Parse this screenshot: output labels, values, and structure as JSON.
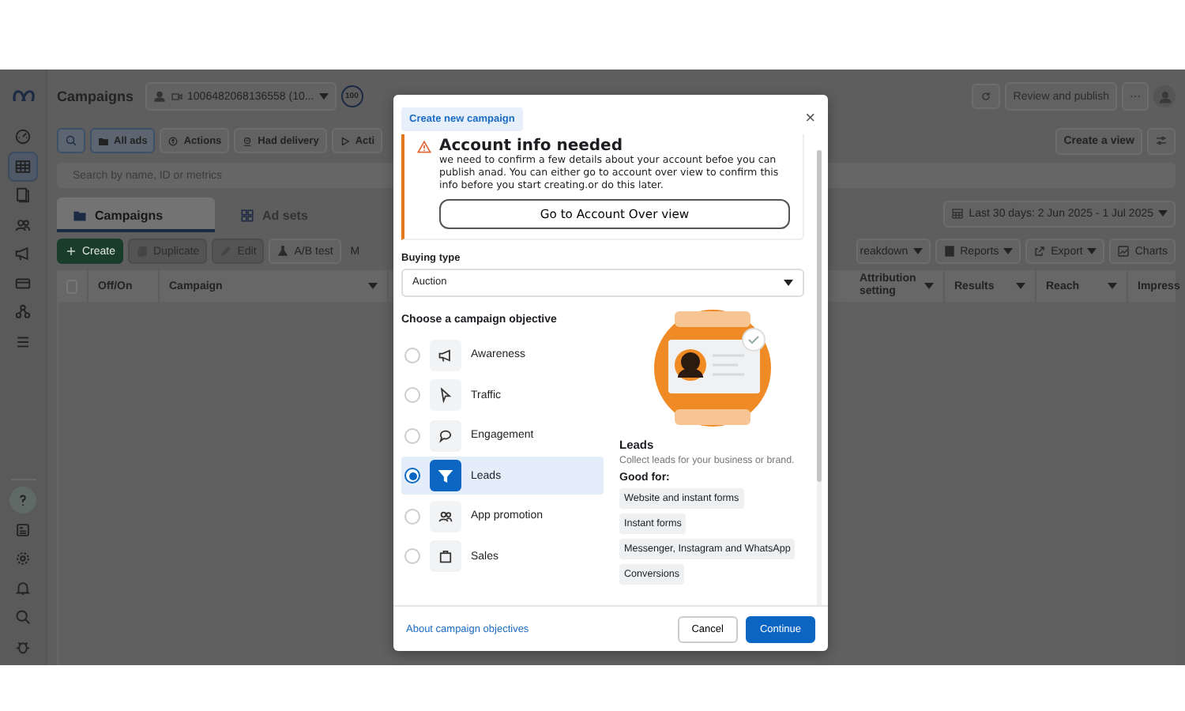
{
  "sidebar": {
    "top_items": [
      {
        "kind": "gauge",
        "selected": false
      },
      {
        "kind": "table",
        "selected": true
      },
      {
        "kind": "pages",
        "selected": false
      },
      {
        "kind": "people",
        "selected": false
      },
      {
        "kind": "megaphone",
        "selected": false
      },
      {
        "kind": "card",
        "selected": false
      },
      {
        "kind": "graph",
        "selected": false
      },
      {
        "kind": "menu",
        "selected": false
      }
    ],
    "bottom_items": [
      {
        "kind": "help",
        "selected": false
      },
      {
        "kind": "news",
        "selected": false
      },
      {
        "kind": "gear",
        "selected": false
      },
      {
        "kind": "bell",
        "selected": false
      },
      {
        "kind": "search",
        "selected": false
      },
      {
        "kind": "bug",
        "selected": false
      }
    ]
  },
  "top_bar": {
    "title": "Campaigns",
    "account": "1006482068136558 (10...",
    "score": "100",
    "publish_button": "Review and publish",
    "more_button": "···"
  },
  "filters": [
    {
      "label": "All ads",
      "kind": "folder",
      "selected": true
    },
    {
      "label": "Actions",
      "kind": "actions",
      "selected": false
    },
    {
      "label": "Had delivery",
      "kind": "delivery",
      "selected": false
    },
    {
      "label": "Acti",
      "kind": "play",
      "selected": false
    }
  ],
  "create_view_button": "Create a view",
  "search": {
    "placeholder": "Search by name, ID or metrics"
  },
  "tabs": [
    {
      "label": "Campaigns",
      "kind": "folder",
      "selected": true
    },
    {
      "label": "Ad sets",
      "kind": "grid",
      "selected": false
    }
  ],
  "date_range": "Last 30 days: 2 Jun 2025 - 1 Jul 2025",
  "toolbar_left": [
    {
      "label": "Create",
      "kind": "plus",
      "disabled": false,
      "primary": true
    },
    {
      "label": "Duplicate",
      "kind": "copy",
      "disabled": true,
      "primary": false
    },
    {
      "label": "Edit",
      "kind": "pencil",
      "disabled": true,
      "primary": false
    },
    {
      "label": "A/B test",
      "kind": "flask",
      "disabled": false,
      "primary": false
    },
    {
      "label": "M",
      "kind": "none",
      "disabled": false,
      "primary": false
    }
  ],
  "toolbar_right": [
    {
      "label": "reakdown",
      "kind": "none",
      "caret": true
    },
    {
      "label": "Reports",
      "kind": "reports",
      "caret": true
    },
    {
      "label": "Export",
      "kind": "export",
      "caret": true
    },
    {
      "label": "Charts",
      "kind": "chart",
      "caret": false
    }
  ],
  "table": {
    "select_all_checked": false,
    "columns": [
      "Off/On",
      "Campaign",
      "Attribution setting",
      "Results",
      "Reach",
      "Impress"
    ]
  },
  "modal": {
    "chip": "Create new campaign",
    "close": "×",
    "alert": {
      "title": "Account info needed",
      "body": "we need to confirm a few details about your account befoe you can publish anad. You can either go to account over view to confirm this info before you start creating.or do this later.",
      "button": "Go to Account Over view"
    },
    "buying_type": {
      "label": "Buying type",
      "value": "Auction"
    },
    "objective_heading": "Choose a campaign objective",
    "objectives": [
      {
        "label": "Awareness",
        "kind": "megaphone",
        "selected": false
      },
      {
        "label": "Traffic",
        "kind": "cursor",
        "selected": false
      },
      {
        "label": "Engagement",
        "kind": "chat",
        "selected": false
      },
      {
        "label": "Leads",
        "kind": "funnel",
        "selected": true
      },
      {
        "label": "App promotion",
        "kind": "people",
        "selected": false
      },
      {
        "label": "Sales",
        "kind": "bag",
        "selected": false
      }
    ],
    "detail": {
      "title": "Leads",
      "description": "Collect leads for your business or brand.",
      "good_for": "Good for:",
      "tags": [
        "Website and instant forms",
        "Instant forms",
        "Messenger, Instagram and WhatsApp",
        "Conversions"
      ]
    },
    "footer": {
      "link": "About campaign objectives",
      "cancel": "Cancel",
      "continue": "Continue"
    }
  }
}
